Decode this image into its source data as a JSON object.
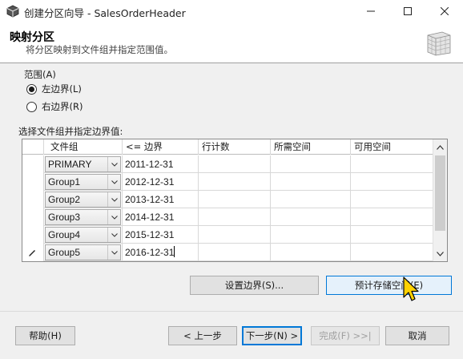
{
  "window": {
    "title": "创建分区向导 - SalesOrderHeader",
    "icons": {
      "app": "database-wizard-icon",
      "minimize": "minimize-icon",
      "maximize": "maximize-icon",
      "close": "close-icon"
    }
  },
  "header": {
    "title": "映射分区",
    "subtitle": "将分区映射到文件组并指定范围值。",
    "icon": "table-grid-icon"
  },
  "range": {
    "label": "范围(A)",
    "options": [
      {
        "label": "左边界(L)",
        "checked": true
      },
      {
        "label": "右边界(R)",
        "checked": false
      }
    ]
  },
  "grid": {
    "label": "选择文件组并指定边界值:",
    "columns": [
      "文件组",
      "<= 边界",
      "行计数",
      "所需空间",
      "可用空间"
    ],
    "rows": [
      {
        "filegroup": "PRIMARY",
        "boundary": "2011-12-31",
        "row_count": "",
        "required_space": "",
        "available_space": ""
      },
      {
        "filegroup": "Group1",
        "boundary": "2012-12-31",
        "row_count": "",
        "required_space": "",
        "available_space": ""
      },
      {
        "filegroup": "Group2",
        "boundary": "2013-12-31",
        "row_count": "",
        "required_space": "",
        "available_space": ""
      },
      {
        "filegroup": "Group3",
        "boundary": "2014-12-31",
        "row_count": "",
        "required_space": "",
        "available_space": ""
      },
      {
        "filegroup": "Group4",
        "boundary": "2015-12-31",
        "row_count": "",
        "required_space": "",
        "available_space": ""
      },
      {
        "filegroup": "Group5",
        "boundary": "2016-12-31",
        "row_count": "",
        "required_space": "",
        "available_space": ""
      }
    ],
    "editing_row_icon": "pencil-icon"
  },
  "actions": {
    "set_boundary": "设置边界(S)...",
    "estimate_storage": "预计存储空间(E)"
  },
  "footer": {
    "help": "帮助(H)",
    "back": "< 上一步",
    "next": "下一步(N) >",
    "finish": "完成(F) >>|",
    "cancel": "取消"
  },
  "colors": {
    "accent": "#0078d7",
    "cursor": "#ffd200"
  }
}
